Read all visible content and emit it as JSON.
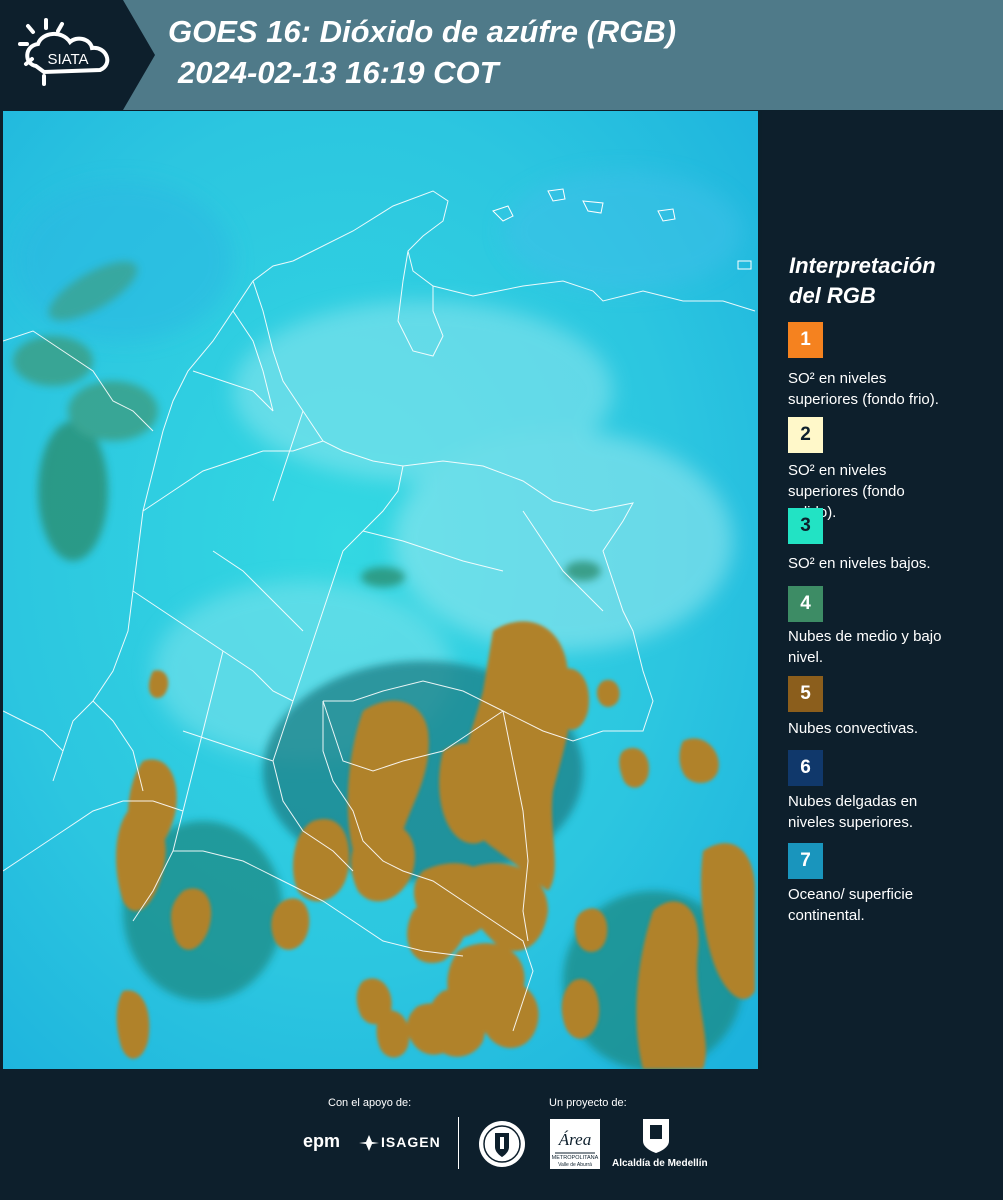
{
  "header": {
    "logo_text": "SIATA",
    "title_line1": "GOES 16: Dióxido de azúfre (RGB)",
    "title_line2": "2024-02-13 16:19 COT"
  },
  "legend": {
    "title_line1": "Interpretación",
    "title_line2": "del RGB",
    "items": [
      {
        "number": "1",
        "color": "#f5821f",
        "text_color": "#ffffff",
        "lines": [
          "SO² en niveles",
          "superiores (fondo frio)."
        ]
      },
      {
        "number": "2",
        "color": "#fff8c9",
        "text_color": "#0d1f2c",
        "lines": [
          "SO² en niveles",
          "superiores (fondo",
          "calido)."
        ]
      },
      {
        "number": "3",
        "color": "#22e3c4",
        "text_color": "#0d1f2c",
        "lines": [
          "SO² en niveles bajos."
        ]
      },
      {
        "number": "4",
        "color": "#3d8c65",
        "text_color": "#ffffff",
        "lines": [
          "Nubes de medio y bajo",
          "nivel."
        ]
      },
      {
        "number": "5",
        "color": "#8b5e1c",
        "text_color": "#ffffff",
        "lines": [
          "Nubes convectivas."
        ]
      },
      {
        "number": "6",
        "color": "#10386b",
        "text_color": "#ffffff",
        "lines": [
          "Nubes delgadas en",
          "niveles superiores."
        ]
      },
      {
        "number": "7",
        "color": "#1995bd",
        "text_color": "#ffffff",
        "lines": [
          "Oceano/ superficie",
          "continental."
        ]
      }
    ]
  },
  "map": {
    "colors": {
      "cyan": "#2fcfe0",
      "deep": "#1ab0dc",
      "convective": "#b0822a",
      "low_cloud": "#2c8a6a",
      "border": "#ffffff"
    }
  },
  "footer": {
    "support_label": "Con el apoyo de:",
    "project_label": "Un proyecto de:",
    "epm": "epm",
    "isagen": "ISAGEN",
    "area_name": "Área",
    "area_sub1": "METROPOLITANA",
    "area_sub2": "Valle de Aburrá",
    "alcaldia": "Alcaldía de Medellín"
  }
}
